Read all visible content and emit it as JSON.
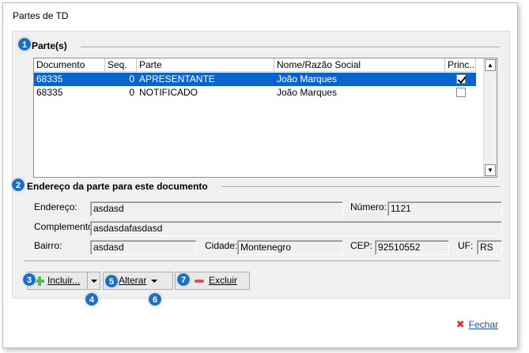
{
  "window": {
    "title": "Partes de TD"
  },
  "badges": [
    "1",
    "2",
    "3",
    "4",
    "5",
    "6",
    "7"
  ],
  "parts_section": {
    "title": "Parte(s)",
    "columns": [
      "Documento",
      "Seq.",
      "Parte",
      "Nome/Razão Social",
      "Princ..."
    ],
    "rows": [
      {
        "documento": "68335",
        "seq": "0",
        "parte": "APRESENTANTE",
        "nome": "João Marques",
        "principal": true,
        "selected": true
      },
      {
        "documento": "68335",
        "seq": "0",
        "parte": "NOTIFICADO",
        "nome": "João Marques",
        "principal": false,
        "selected": false
      }
    ]
  },
  "address_section": {
    "title": "Endereço da parte para este documento",
    "endereco_label": "Endereço:",
    "endereco_value": "asdasd",
    "numero_label": "Número:",
    "numero_value": "1121",
    "complemento_label": "Complemento:",
    "complemento_value": "asdasdafasdasd",
    "bairro_label": "Bairro:",
    "bairro_value": "asdasd",
    "cidade_label": "Cidade:",
    "cidade_value": "Montenegro",
    "cep_label": "CEP:",
    "cep_value": "92510552",
    "uf_label": "UF:",
    "uf_value": "RS"
  },
  "buttons": {
    "incluir": "Incluir...",
    "alterar": "Alterar",
    "excluir": "Excluir",
    "fechar": "Fechar"
  },
  "icons": {
    "add": "plus-icon",
    "remove": "minus-icon",
    "close": "close-icon",
    "dropdown": "chevron-down-icon",
    "scroll_up": "scroll-up-icon",
    "scroll_down": "scroll-down-icon"
  },
  "colors": {
    "badge": "#1d6fbf",
    "selection": "#0a64d0",
    "link": "#1a4fa3",
    "close_x": "#d03030",
    "add": "#5cb85c",
    "remove": "#e05050"
  }
}
